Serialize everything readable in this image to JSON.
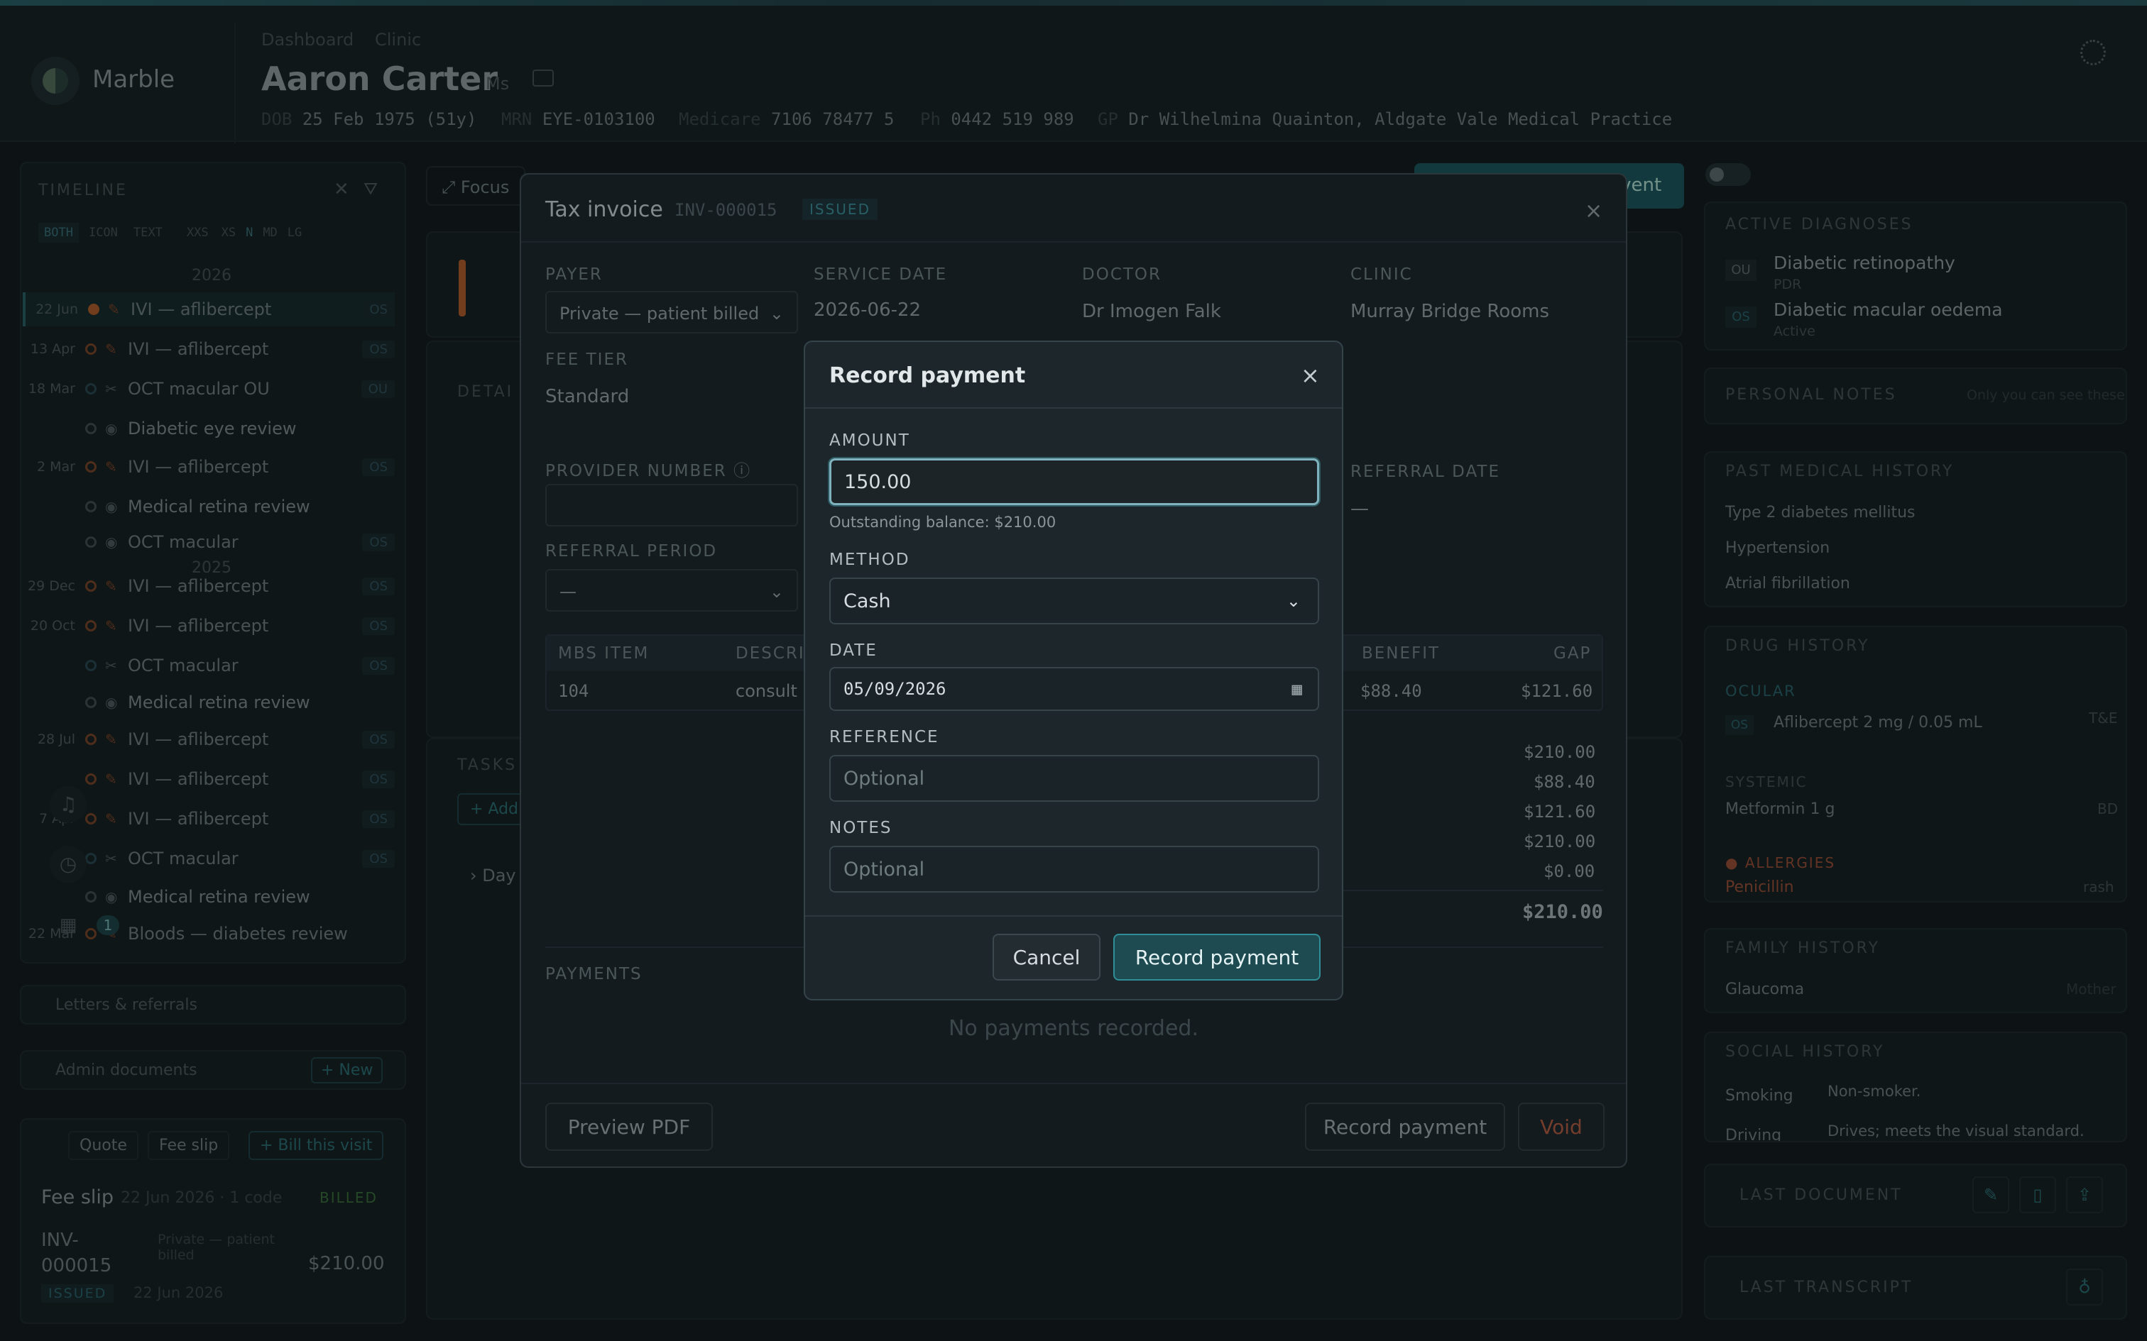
{
  "app": {
    "brand": "Marble"
  },
  "breadcrumb": [
    "Dashboard",
    "Clinic"
  ],
  "patient": {
    "name": "Aaron Carter",
    "title": "Ms",
    "meta": [
      {
        "k": "DOB",
        "v": "25 Feb 1975 (51y)"
      },
      {
        "k": "MRN",
        "v": "EYE-0103100"
      },
      {
        "k": "Medicare",
        "v": "7106 78477 5"
      },
      {
        "k": "Ph",
        "v": "0442 519 989"
      },
      {
        "k": "GP",
        "v": "Dr Wilhelmina Quainton, Aldgate Vale Medical Practice"
      }
    ]
  },
  "timeline": {
    "title": "TIMELINE",
    "filters": [
      "BOTH",
      "ICON",
      "TEXT",
      "XXS",
      "XS",
      "N",
      "MD",
      "LG"
    ],
    "year1": "2026",
    "year2": "2025",
    "rows": [
      {
        "date": "22 Jun",
        "label": "IVI — aflibercept",
        "badge": "OS",
        "dot": "fill"
      },
      {
        "date": "13 Apr",
        "label": "IVI — aflibercept",
        "badge": "OS",
        "dot": "o"
      },
      {
        "date": "18 Mar",
        "label": "OCT macular OU",
        "badge": "OU",
        "dot": "blue"
      },
      {
        "date": "",
        "label": "Diabetic eye review",
        "badge": "",
        "dot": "gray"
      },
      {
        "date": "2 Mar",
        "label": "IVI — aflibercept",
        "badge": "OS",
        "dot": "o"
      },
      {
        "date": "",
        "label": "Medical retina review",
        "badge": "",
        "dot": "gray"
      },
      {
        "date": "",
        "label": "OCT macular",
        "badge": "OS",
        "dot": "gray"
      },
      {
        "date": "29 Dec",
        "label": "IVI — aflibercept",
        "badge": "OS",
        "dot": "o"
      },
      {
        "date": "20 Oct",
        "label": "IVI — aflibercept",
        "badge": "OS",
        "dot": "o"
      },
      {
        "date": "",
        "label": "OCT macular",
        "badge": "OS",
        "dot": "blue"
      },
      {
        "date": "",
        "label": "Medical retina review",
        "badge": "",
        "dot": "gray"
      },
      {
        "date": "28 Jul",
        "label": "IVI — aflibercept",
        "badge": "OS",
        "dot": "o"
      },
      {
        "date": "",
        "label": "IVI — aflibercept",
        "badge": "OS",
        "dot": "o"
      },
      {
        "date": "7 Apr",
        "label": "IVI — aflibercept",
        "badge": "OS",
        "dot": "o"
      },
      {
        "date": "",
        "label": "OCT macular",
        "badge": "OS",
        "dot": "blue"
      },
      {
        "date": "",
        "label": "Medical retina review",
        "badge": "",
        "dot": "gray"
      },
      {
        "date": "22 Mar",
        "label": "Bloods — diabetes review",
        "badge": "",
        "dot": "o"
      }
    ],
    "notif_count": "1"
  },
  "left_sections": {
    "letters": "Letters & referrals",
    "admin": "Admin documents",
    "new_btn": "+ New",
    "quote": "Quote",
    "fee_slip_btn": "Fee slip",
    "bill": "+ Bill this visit",
    "fee_slip_title": "Fee slip",
    "fee_slip_meta": "22 Jun 2026 · 1 code",
    "fee_slip_status": "BILLED",
    "inv_number": "INV-000015",
    "inv_payer": "Private — patient billed",
    "inv_amount": "$210.00",
    "inv_status": "ISSUED",
    "inv_date": "22 Jun 2026"
  },
  "center": {
    "focus": "Focus",
    "detail": "DETAI",
    "tasks": "TASKS",
    "add": "+ Add",
    "day": "Day",
    "record_event": "Record event"
  },
  "right": {
    "active_dx_title": "ACTIVE DIAGNOSES",
    "dx": [
      {
        "eye": "OU",
        "name": "Diabetic retinopathy",
        "sub": "PDR"
      },
      {
        "eye": "OS",
        "name": "Diabetic macular oedema",
        "sub": "Active"
      }
    ],
    "personal_notes": "PERSONAL NOTES",
    "personal_hint": "Only you can see these",
    "pmh_title": "PAST MEDICAL HISTORY",
    "pmh": [
      "Type 2 diabetes mellitus",
      "Hypertension",
      "Atrial fibrillation"
    ],
    "drug_title": "DRUG HISTORY",
    "ocular": "OCULAR",
    "ocular_eye": "OS",
    "ocular_drug": "Aflibercept 2 mg / 0.05 mL",
    "ocular_freq": "T&E",
    "systemic": "SYSTEMIC",
    "sys_drug": "Metformin 1 g",
    "sys_freq": "BD",
    "allergies": "ALLERGIES",
    "allergy": "Penicillin",
    "allergy_rx": "rash",
    "family_title": "FAMILY HISTORY",
    "family_item": "Glaucoma",
    "family_rel": "Mother",
    "social_title": "SOCIAL HISTORY",
    "smoking_k": "Smoking",
    "smoking_v": "Non-smoker.",
    "driving_k": "Driving",
    "driving_v": "Drives; meets the visual standard.",
    "last_doc": "LAST DOCUMENT",
    "last_tx": "LAST TRANSCRIPT"
  },
  "invoice": {
    "title": "Tax invoice",
    "number": "INV-000015",
    "status": "ISSUED",
    "payer_label": "PAYER",
    "payer": "Private — patient billed",
    "service_date_label": "SERVICE DATE",
    "service_date": "2026-06-22",
    "doctor_label": "DOCTOR",
    "doctor": "Dr Imogen Falk",
    "clinic_label": "CLINIC",
    "clinic": "Murray Bridge Rooms",
    "fee_tier_label": "FEE TIER",
    "fee_tier": "Standard",
    "provider_label": "PROVIDER NUMBER",
    "referral_date_label": "REFERRAL DATE",
    "referral_date": "—",
    "referral_period_label": "REFERRAL PERIOD",
    "referral_period": "—",
    "cols": [
      "MBS ITEM",
      "DESCRI",
      "BENEFIT",
      "GAP"
    ],
    "row": {
      "item": "104",
      "desc": "consult",
      "benefit": "$88.40",
      "gap": "$121.60"
    },
    "totals": [
      "$210.00",
      "$88.40",
      "$121.60",
      "$210.00",
      "$0.00"
    ],
    "grand_total": "$210.00",
    "payments_label": "PAYMENTS",
    "no_payments": "No payments recorded.",
    "preview_btn": "Preview PDF",
    "record_btn": "Record payment",
    "void_btn": "Void"
  },
  "payment_dialog": {
    "title": "Record payment",
    "amount_label": "AMOUNT",
    "amount": "150.00",
    "balance": "Outstanding balance: $210.00",
    "method_label": "METHOD",
    "method": "Cash",
    "date_label": "DATE",
    "date": "05/09/2026",
    "reference_label": "REFERENCE",
    "reference_ph": "Optional",
    "notes_label": "NOTES",
    "notes_ph": "Optional",
    "cancel": "Cancel",
    "submit": "Record payment"
  },
  "colors": {
    "accent": "#2e8f96",
    "orange": "#c8662a",
    "danger": "#c0543a"
  }
}
